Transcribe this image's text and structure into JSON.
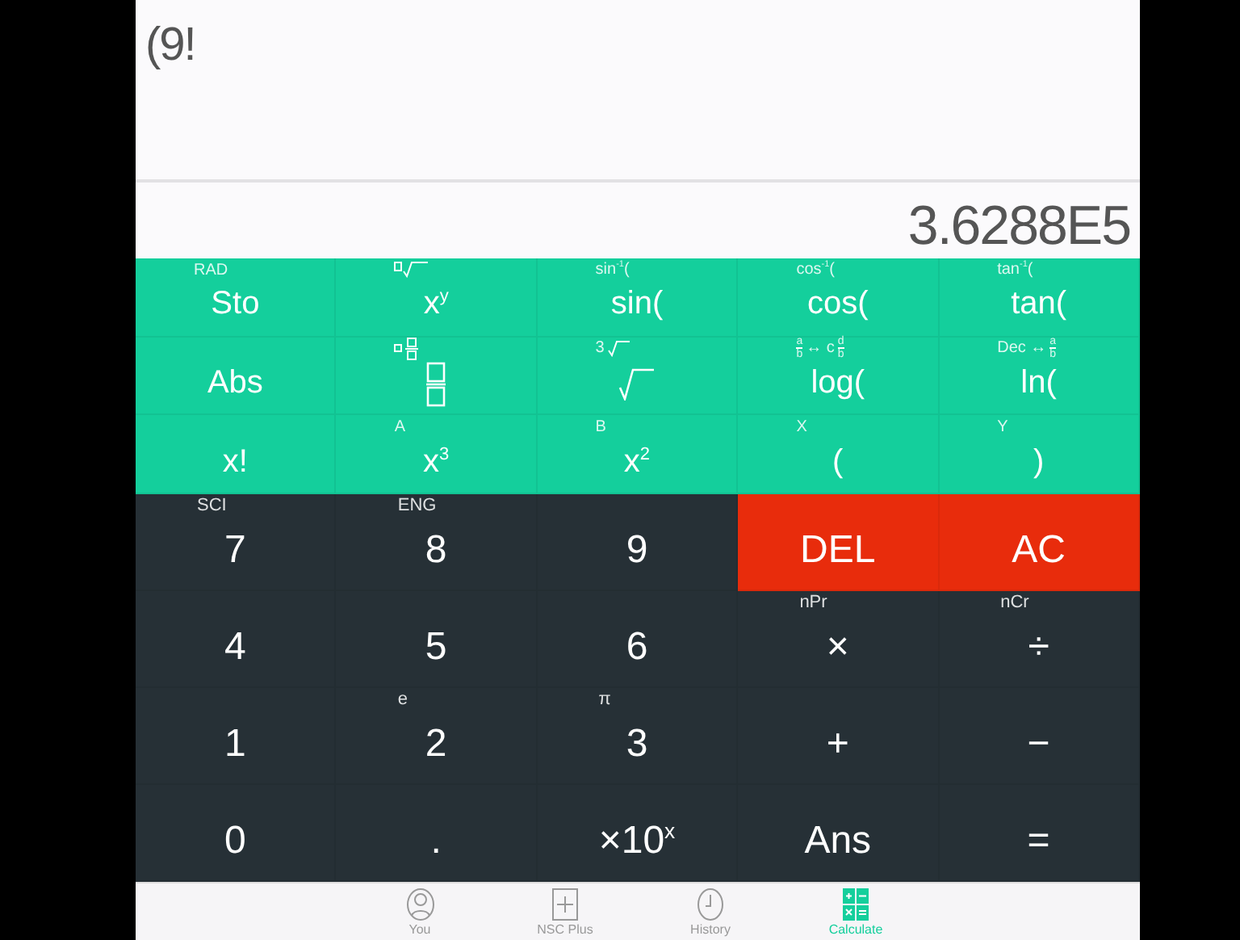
{
  "display": {
    "expression": "(9!",
    "result": "3.6288E5"
  },
  "rows": [
    [
      {
        "kind": "fn",
        "sub": [
          {
            "t": "RAD"
          }
        ],
        "label": "Sto"
      },
      {
        "kind": "fn",
        "sub": [
          {
            "kind": "box-root"
          }
        ],
        "label": "x$^{y}$"
      },
      {
        "kind": "fn",
        "sub": [
          {
            "t": "sin$^{-1}$("
          }
        ],
        "label": "sin("
      },
      {
        "kind": "fn",
        "sub": [
          {
            "t": "cos$^{-1}$("
          }
        ],
        "label": "cos("
      },
      {
        "kind": "fn",
        "sub": [
          {
            "t": "tan$^{-1}$("
          }
        ],
        "label": "tan("
      }
    ],
    [
      {
        "kind": "fn",
        "label": "Abs"
      },
      {
        "kind": "fraction",
        "sub": [
          {
            "kind": "mixed-fraction"
          }
        ]
      },
      {
        "kind": "root",
        "sub": [
          {
            "t": "3"
          },
          {
            "kind": "radical"
          }
        ]
      },
      {
        "kind": "fn",
        "sub": [
          {
            "num": "a",
            "den": "b"
          },
          {
            "t": "↔ c"
          },
          {
            "num": "d",
            "den": "b"
          }
        ],
        "label": "log("
      },
      {
        "kind": "fn",
        "sub": [
          {
            "t": "Dec ↔"
          },
          {
            "num": "a",
            "den": "b"
          }
        ],
        "label": "ln("
      }
    ],
    [
      {
        "kind": "fn",
        "label": "x!"
      },
      {
        "kind": "fn",
        "sub": [
          {
            "t": "A"
          }
        ],
        "label": "x$^{3}$"
      },
      {
        "kind": "fn",
        "sub": [
          {
            "t": "B"
          }
        ],
        "label": "x$^{2}$"
      },
      {
        "kind": "fn",
        "sub": [
          {
            "t": "X"
          }
        ],
        "label": "("
      },
      {
        "kind": "fn",
        "sub": [
          {
            "t": "Y"
          }
        ],
        "label": ")"
      }
    ],
    [
      {
        "kind": "num",
        "sub": [
          {
            "t": "SCI"
          }
        ],
        "label": "7"
      },
      {
        "kind": "num",
        "sub": [
          {
            "t": "ENG"
          }
        ],
        "label": "8"
      },
      {
        "kind": "num",
        "label": "9"
      },
      {
        "kind": "clear",
        "label": "DEL"
      },
      {
        "kind": "clear",
        "label": "AC"
      }
    ],
    [
      {
        "kind": "num",
        "label": "4"
      },
      {
        "kind": "num",
        "label": "5"
      },
      {
        "kind": "num",
        "label": "6"
      },
      {
        "kind": "num",
        "sub": [
          {
            "t": "nPr"
          }
        ],
        "label": "×"
      },
      {
        "kind": "num",
        "sub": [
          {
            "t": "nCr"
          }
        ],
        "label": "÷"
      }
    ],
    [
      {
        "kind": "num",
        "label": "1"
      },
      {
        "kind": "num",
        "sub": [
          {
            "t": "e"
          }
        ],
        "label": "2"
      },
      {
        "kind": "num",
        "sub": [
          {
            "t": "π"
          }
        ],
        "label": "3"
      },
      {
        "kind": "num",
        "label": "+"
      },
      {
        "kind": "num",
        "label": "−"
      }
    ],
    [
      {
        "kind": "num",
        "label": "0"
      },
      {
        "kind": "num",
        "label": "."
      },
      {
        "kind": "num",
        "label": "×10$^{x}$"
      },
      {
        "kind": "num",
        "label": "Ans"
      },
      {
        "kind": "num",
        "label": "="
      }
    ]
  ],
  "tabs": [
    {
      "label": "You",
      "kind": "person",
      "selected": false
    },
    {
      "label": "NSC Plus",
      "kind": "plus",
      "selected": false
    },
    {
      "label": "History",
      "kind": "clock",
      "selected": false
    },
    {
      "label": "Calculate",
      "kind": "calculator",
      "selected": true
    }
  ]
}
